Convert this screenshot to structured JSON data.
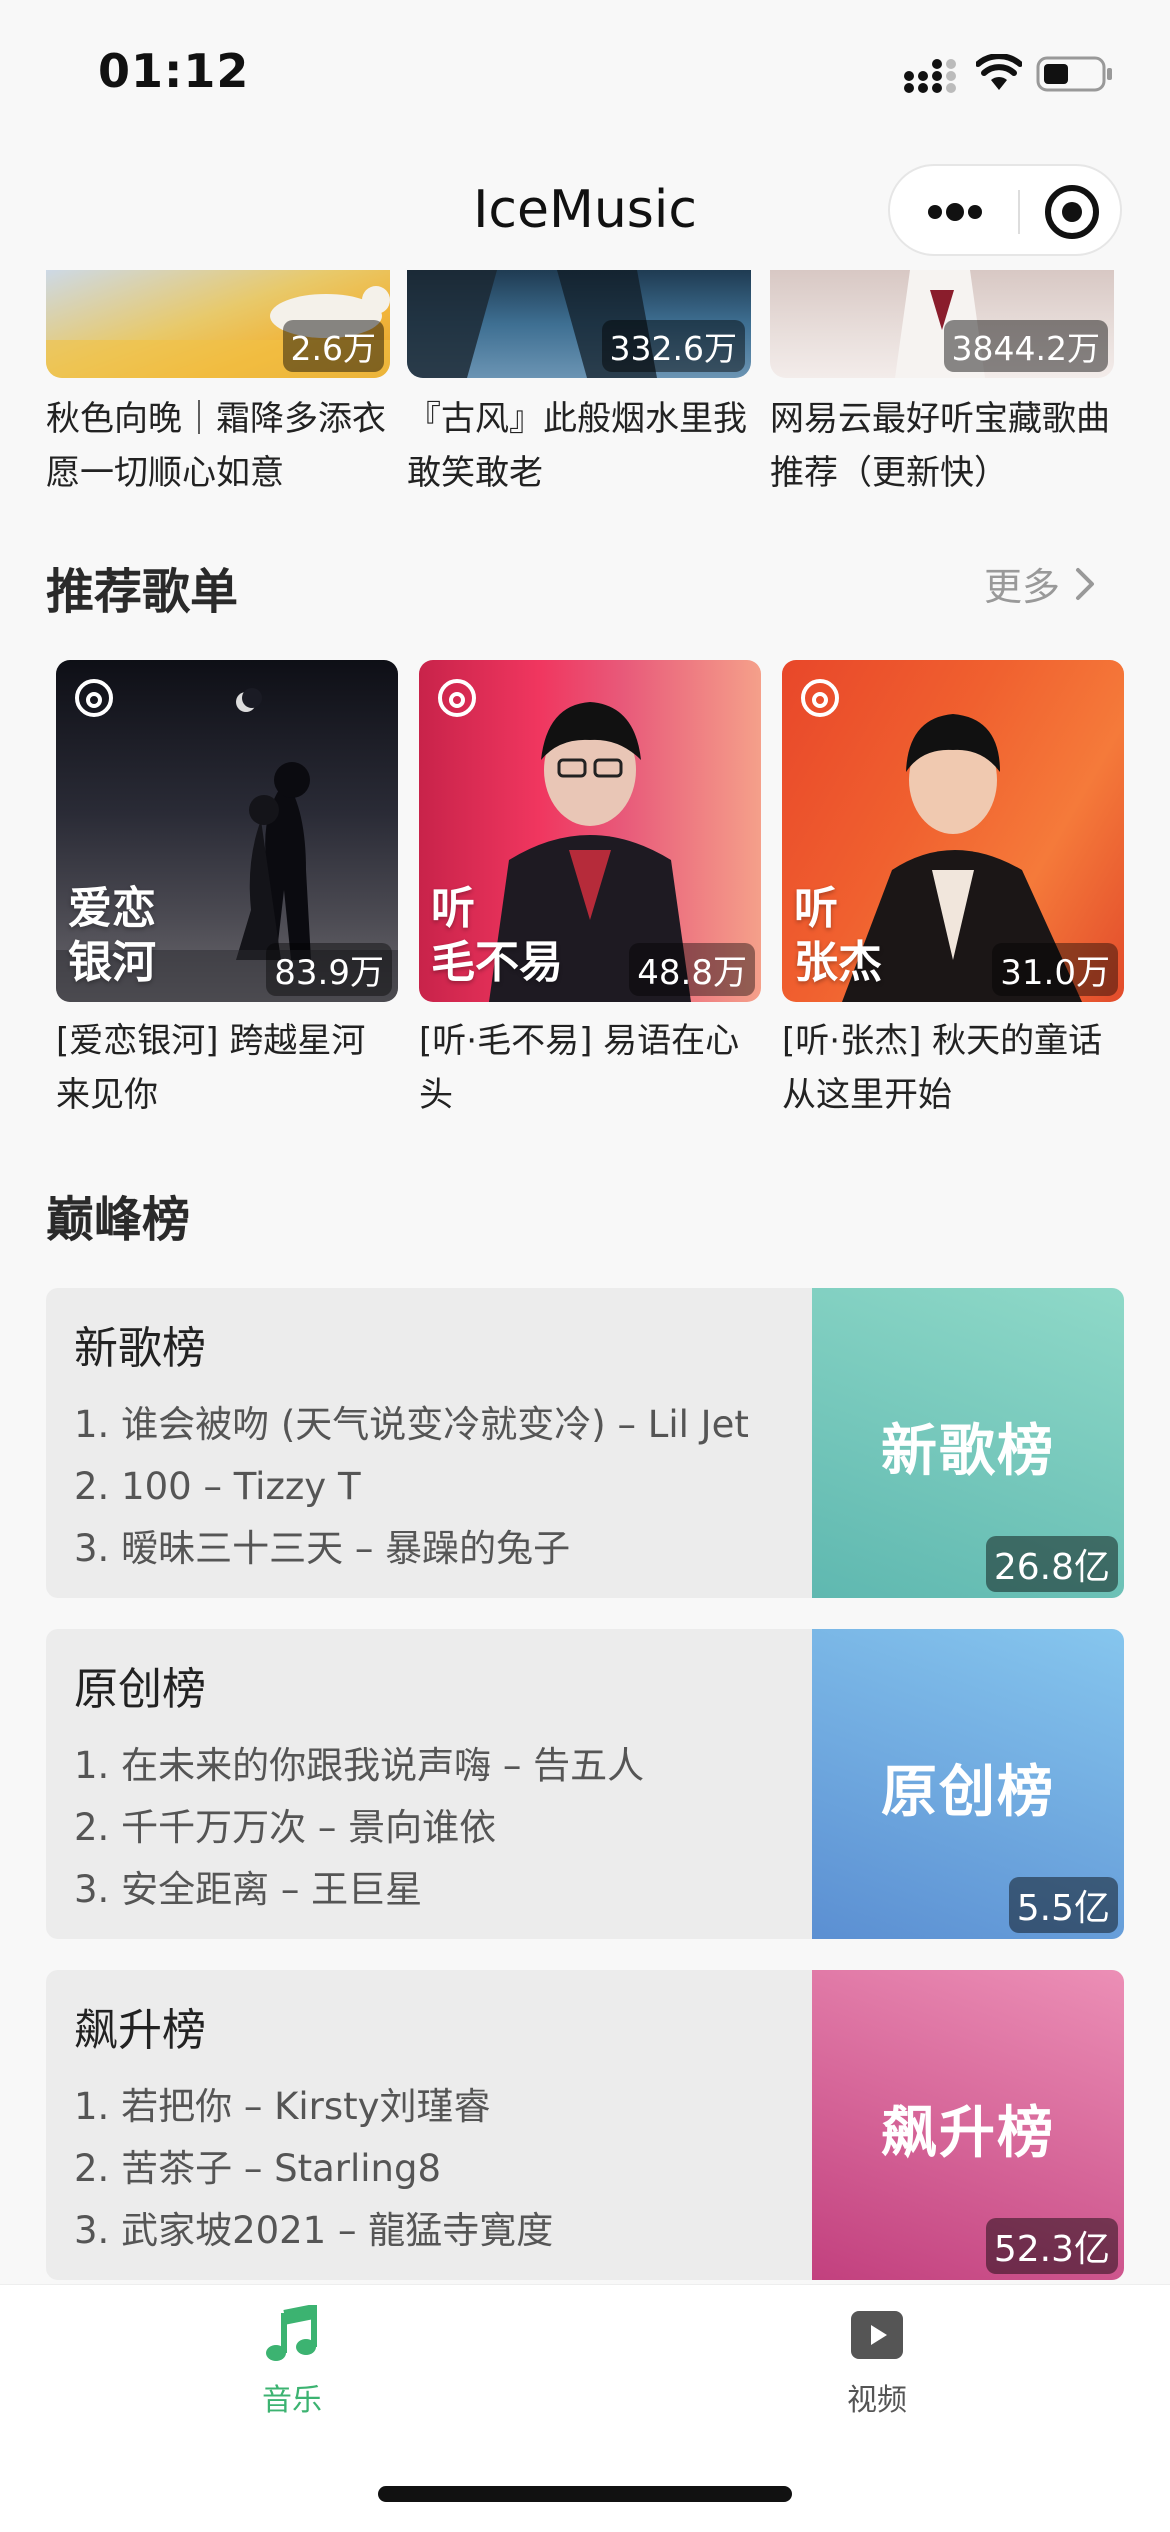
{
  "status_bar": {
    "time": "01:12"
  },
  "header": {
    "title": "IceMusic"
  },
  "top_lists": [
    {
      "count": "2.6万",
      "title": "秋色向晚｜霜降多添衣 愿一切顺心如意"
    },
    {
      "count": "332.6万",
      "title": "『古风』此般烟水里我敢笑敢老"
    },
    {
      "count": "3844.2万",
      "title": "网易云最好听宝藏歌曲推荐（更新快）"
    }
  ],
  "recommended": {
    "title": "推荐歌单",
    "more": "更多",
    "items": [
      {
        "cover_text": [
          "爱恋",
          "银河"
        ],
        "count": "83.9万",
        "title": "[爱恋银河] 跨越星河来见你"
      },
      {
        "cover_text": [
          "听",
          "毛不易"
        ],
        "count": "48.8万",
        "title": "[听·毛不易] 易语在心头"
      },
      {
        "cover_text": [
          "听",
          "张杰"
        ],
        "count": "31.0万",
        "title": "[听·张杰] 秋天的童话从这里开始"
      }
    ]
  },
  "peak": {
    "title": "巅峰榜",
    "charts": [
      {
        "name": "新歌榜",
        "songs": [
          "1. 谁会被吻 (天气说变冷就变冷) – Lil Jet",
          "2. 100 – Tizzy T",
          "3. 暧昧三十三天 – 暴躁的兔子"
        ],
        "cover_label": "新歌榜",
        "count": "26.8亿",
        "gradient": [
          "#5fb8b0",
          "#8fd9c8"
        ]
      },
      {
        "name": "原创榜",
        "songs": [
          "1. 在未来的你跟我说声嗨 – 告五人",
          "2. 千千万万次 – 景向谁依",
          "3. 安全距离 – 王巨星"
        ],
        "cover_label": "原创榜",
        "count": "5.5亿",
        "gradient": [
          "#5b8fd2",
          "#86c6ee"
        ]
      },
      {
        "name": "飙升榜",
        "songs": [
          "1. 若把你 – Kirsty刘瑾睿",
          "2. 苦茶子 – Starling8",
          "3. 武家坡2021 – 龍猛寺寛度"
        ],
        "cover_label": "飙升榜",
        "count": "52.3亿",
        "gradient": [
          "#c2407e",
          "#ec8fb6"
        ]
      }
    ]
  },
  "tabs": [
    {
      "label": "音乐",
      "icon": "music-note-icon",
      "active": true,
      "color": "#3cb371"
    },
    {
      "label": "视频",
      "icon": "video-play-icon",
      "active": false,
      "color": "#555555"
    }
  ]
}
